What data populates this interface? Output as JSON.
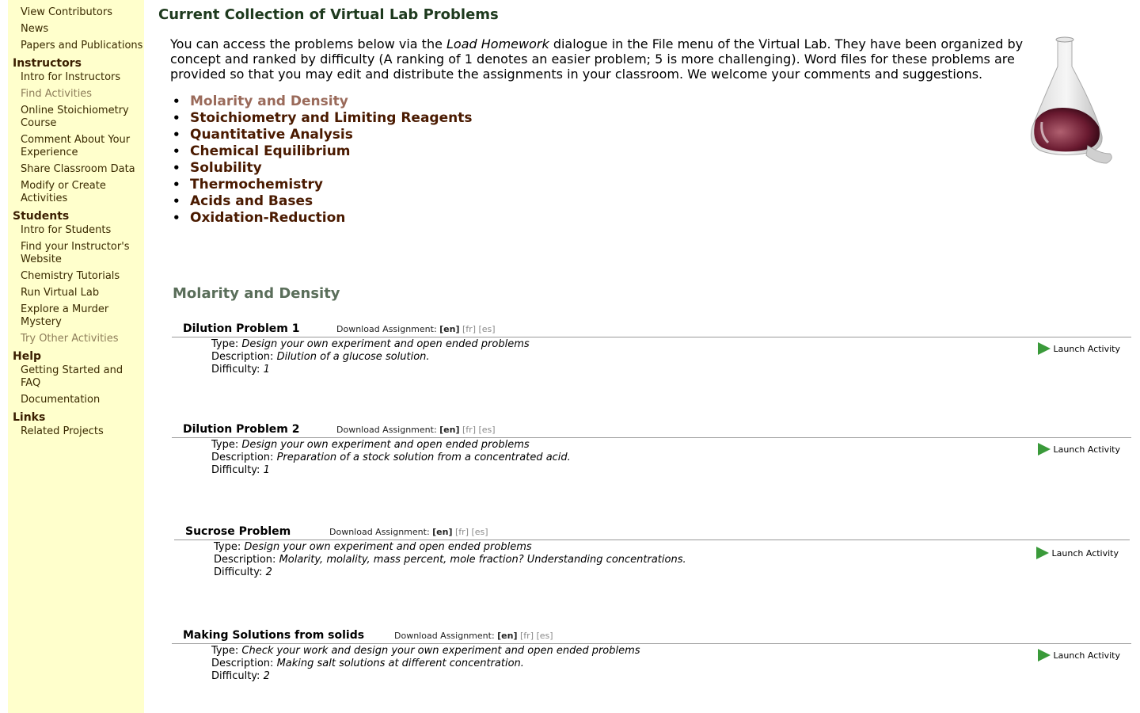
{
  "sidebar": {
    "top_items": [
      {
        "label": "View Contributors"
      },
      {
        "label": "News"
      },
      {
        "label": "Papers and Publications"
      }
    ],
    "sections": [
      {
        "heading": "Instructors",
        "items": [
          {
            "label": "Intro for Instructors"
          },
          {
            "label": "Find Activities"
          },
          {
            "label": "Online Stoichiometry Course"
          },
          {
            "label": "Comment About Your Experience"
          },
          {
            "label": "Share Classroom Data"
          },
          {
            "label": "Modify or Create Activities"
          }
        ]
      },
      {
        "heading": "Students",
        "items": [
          {
            "label": "Intro for Students"
          },
          {
            "label": "Find your Instructor's Website"
          },
          {
            "label": "Chemistry Tutorials"
          },
          {
            "label": "Run Virtual Lab"
          },
          {
            "label": "Explore a Murder Mystery"
          },
          {
            "label": "Try Other Activities"
          }
        ]
      },
      {
        "heading": "Help",
        "items": [
          {
            "label": "Getting Started and FAQ"
          },
          {
            "label": "Documentation"
          }
        ]
      },
      {
        "heading": "Links",
        "items": [
          {
            "label": "Related Projects"
          }
        ]
      }
    ]
  },
  "main": {
    "title": "Current Collection of Virtual Lab Problems",
    "intro_before": "You can access the problems below via the ",
    "intro_italic": "Load Homework",
    "intro_after": " dialogue in the File menu of the Virtual Lab. They have been organized by concept and ranked by difficulty (A ranking of 1 denotes an easier problem; 5 is more challenging). Word files for these problems are provided so that you may edit and distribute the assignments in your classroom. We welcome your comments and suggestions.",
    "topics": [
      "Molarity and Density",
      "Stoichiometry and Limiting Reagents",
      "Quantitative Analysis",
      "Chemical Equilibrium",
      "Solubility",
      "Thermochemistry",
      "Acids and Bases",
      "Oxidation-Reduction"
    ],
    "section_title": "Molarity and Density",
    "download_label": "Download Assignment:",
    "lang_en": "[en]",
    "lang_fr": "[fr]",
    "lang_es": "[es]",
    "type_label": "Type:",
    "description_label": "Description:",
    "difficulty_label": "Difficulty:",
    "launch_label": "Launch Activity",
    "problems": [
      {
        "name": "Dilution Problem 1",
        "type": "Design your own experiment and open ended problems",
        "description": "Dilution of a glucose solution.",
        "difficulty": "1"
      },
      {
        "name": "Dilution Problem 2",
        "type": "Design your own experiment and open ended problems",
        "description": "Preparation of a stock solution from a concentrated acid.",
        "difficulty": "1"
      },
      {
        "name": "Sucrose Problem",
        "type": "Design your own experiment and open ended problems",
        "description": "Molarity, molality, mass percent, mole fraction? Understanding concentrations.",
        "difficulty": "2"
      },
      {
        "name": "Making Solutions from solids",
        "type": "Check your work and design your own experiment and open ended problems",
        "description": "Making salt solutions at different concentration.",
        "difficulty": "2"
      }
    ]
  }
}
